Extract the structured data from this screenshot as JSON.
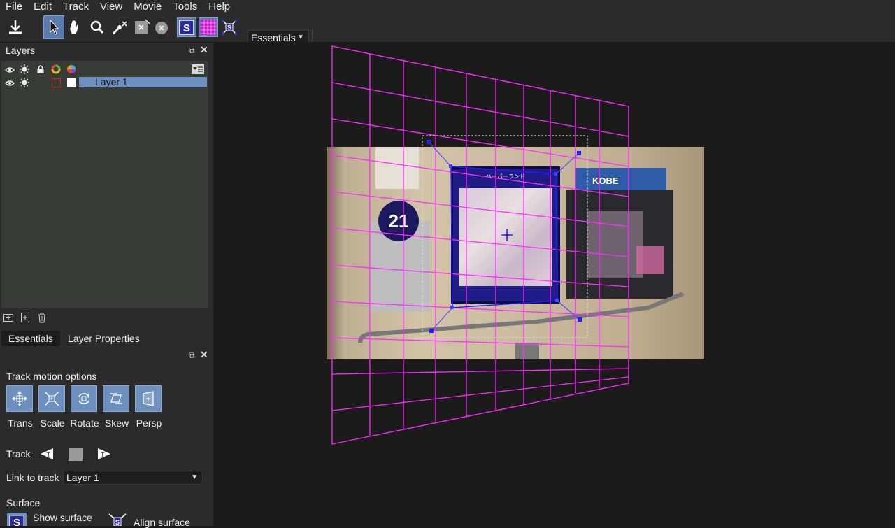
{
  "menu": [
    "File",
    "Edit",
    "Track",
    "View",
    "Movie",
    "Tools",
    "Help"
  ],
  "toolbar": {
    "workspace_label": "Essentials",
    "buttons": [
      "export-icon",
      "select-arrow-icon",
      "hand-pan-icon",
      "zoom-icon",
      "add-point-icon",
      "x-box-icon",
      "x-circle-icon",
      "surface-s-icon",
      "grid-icon",
      "align-surface-icon"
    ]
  },
  "layers_panel": {
    "title": "Layers",
    "layers": [
      {
        "name": "Layer 1"
      }
    ],
    "colors": {
      "selection": "#6d90bf",
      "layer_color": "#d02020"
    }
  },
  "tabs": [
    "Essentials",
    "Layer Properties"
  ],
  "properties": {
    "track_motion_title": "Track motion options",
    "motion_buttons": [
      "Trans",
      "Scale",
      "Rotate",
      "Skew",
      "Persp"
    ],
    "track_label": "Track",
    "link_to_track_label": "Link to track",
    "link_to_track_value": "Layer 1",
    "surface_label": "Surface",
    "show_surface_label": "Show surface",
    "align_surface_label": "Align surface"
  },
  "viewer": {
    "sign_number": "21",
    "sign_text": "KOBE HARBORLAND",
    "map_title": "ハーバーランド",
    "grid_color": "#ff2cff",
    "track_color": "#2020ff"
  }
}
